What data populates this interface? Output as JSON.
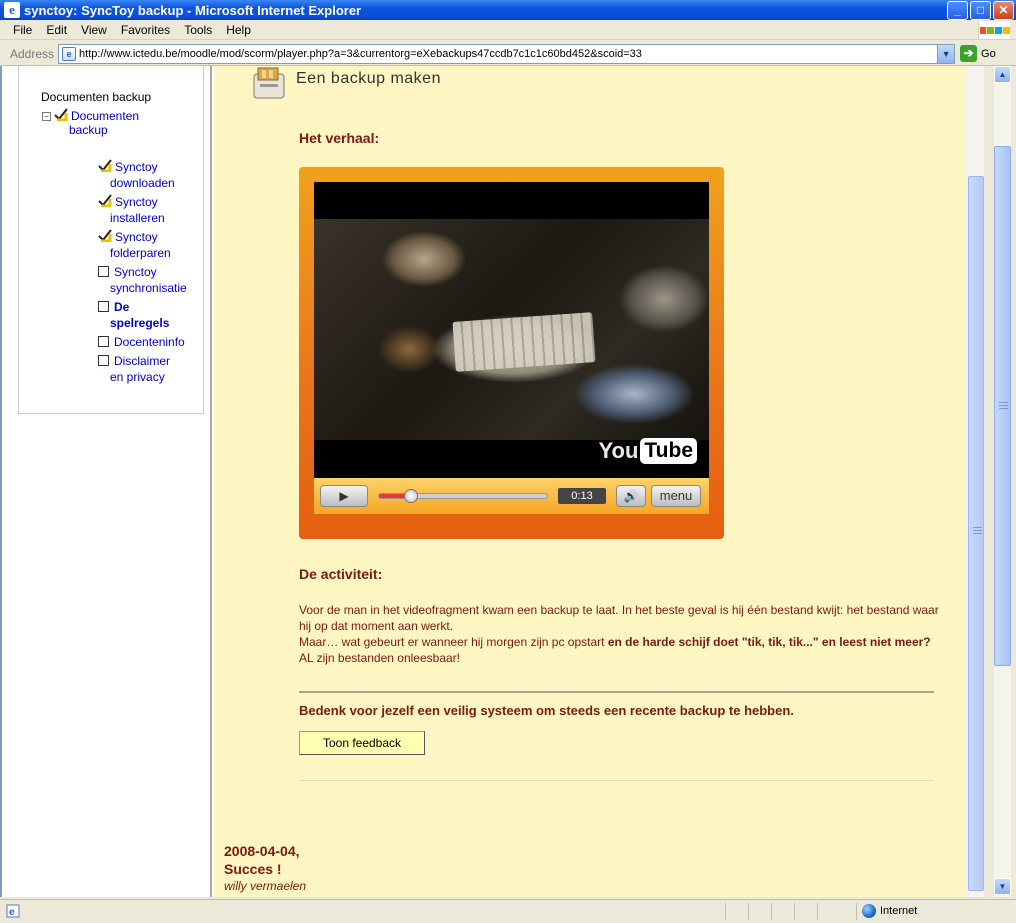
{
  "window": {
    "title": "synctoy: SyncToy backup - Microsoft Internet Explorer",
    "minimize": "_",
    "maximize": "□",
    "close": "✕"
  },
  "menu": [
    "File",
    "Edit",
    "View",
    "Favorites",
    "Tools",
    "Help"
  ],
  "address": {
    "label": "Address",
    "url": "http://www.ictedu.be/moodle/mod/scorm/player.php?a=3&currentorg=eXebackups47ccdb7c1c1c60bd452&scoid=33",
    "go_label": "Go"
  },
  "toc": {
    "heading": "Documenten backup",
    "root": {
      "line1": "Documenten",
      "line2": "backup"
    },
    "items": [
      {
        "line1": "Synctoy",
        "line2": "downloaden",
        "status": "completed"
      },
      {
        "line1": "Synctoy",
        "line2": "installeren",
        "status": "completed"
      },
      {
        "line1": "Synctoy",
        "line2": "folderparen",
        "status": "completed"
      },
      {
        "line1": "Synctoy",
        "line2": "synchronisatie",
        "status": "not-attempted"
      },
      {
        "line1": "De",
        "line2": "spelregels",
        "status": "current"
      },
      {
        "line1": "Docenteninfo",
        "line2": "",
        "status": "not-attempted"
      },
      {
        "line1": "Disclaimer",
        "line2": "en privacy",
        "status": "not-attempted"
      }
    ]
  },
  "lesson": {
    "title": "Een backup maken",
    "story_heading": "Het verhaal:",
    "video": {
      "brand_you": "You",
      "brand_tube": "Tube",
      "time": "0:13",
      "menu_label": "menu",
      "progress": 0.19
    },
    "activity_heading": "De activiteit:",
    "paragraph": {
      "part1": "Voor de man in het videofragment kwam een backup te laat. In het beste geval is hij één bestand kwijt: het bestand waar hij op dat moment aan werkt.",
      "part2": "Maar… wat gebeurt er wanneer hij morgen zijn pc opstart ",
      "part3_bold": "en de harde schijf doet \"tik, tik, tik...\" en leest niet meer?",
      "part4": " AL zijn bestanden onleesbaar!"
    },
    "callout": "Bedenk voor jezelf een veilig systeem om steeds een recente backup te hebben.",
    "feedback_button": "Toon feedback",
    "footer": {
      "date": "2008-04-04,",
      "greeting": "Succes !",
      "author": "willy vermaelen"
    }
  },
  "status": {
    "zone": "Internet"
  },
  "colors": {
    "content_bg": "#fdf6c3",
    "heading": "#7a1a10",
    "link": "#0000cc",
    "player_orange": "#e9731a"
  }
}
